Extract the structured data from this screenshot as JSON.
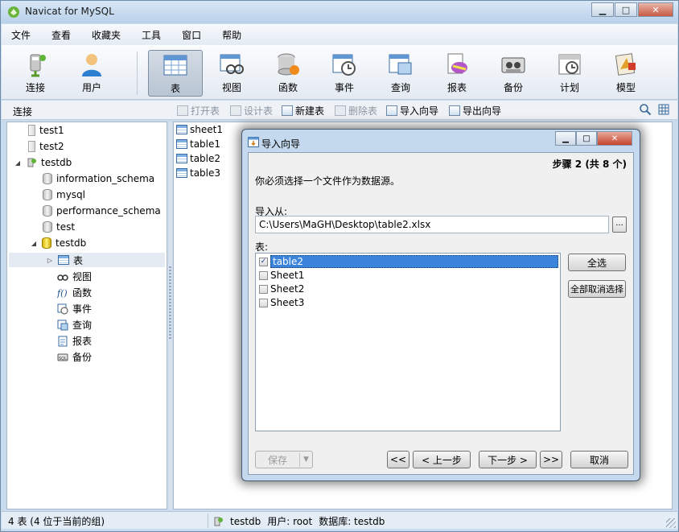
{
  "app": {
    "title": "Navicat for MySQL"
  },
  "window_controls": {
    "minimize": "▁",
    "maximize": "□",
    "close": "✕"
  },
  "menu": [
    "文件",
    "查看",
    "收藏夹",
    "工具",
    "窗口",
    "帮助"
  ],
  "toolbar": [
    {
      "label": "连接",
      "icon": "connect-icon"
    },
    {
      "label": "用户",
      "icon": "user-icon"
    },
    {
      "label": "表",
      "icon": "table-icon",
      "active": true
    },
    {
      "label": "视图",
      "icon": "view-icon"
    },
    {
      "label": "函数",
      "icon": "function-icon"
    },
    {
      "label": "事件",
      "icon": "event-icon"
    },
    {
      "label": "查询",
      "icon": "query-icon"
    },
    {
      "label": "报表",
      "icon": "report-icon"
    },
    {
      "label": "备份",
      "icon": "backup-icon"
    },
    {
      "label": "计划",
      "icon": "schedule-icon"
    },
    {
      "label": "模型",
      "icon": "model-icon"
    }
  ],
  "subbar": {
    "title": "连接",
    "actions": [
      {
        "label": "打开表",
        "enabled": false
      },
      {
        "label": "设计表",
        "enabled": false
      },
      {
        "label": "新建表",
        "enabled": true
      },
      {
        "label": "删除表",
        "enabled": false
      },
      {
        "label": "导入向导",
        "enabled": true
      },
      {
        "label": "导出向导",
        "enabled": true
      }
    ]
  },
  "tree": [
    {
      "label": "test1",
      "kind": "connection"
    },
    {
      "label": "test2",
      "kind": "connection"
    },
    {
      "label": "testdb",
      "kind": "connection-open"
    },
    {
      "label": "information_schema",
      "kind": "database"
    },
    {
      "label": "mysql",
      "kind": "database"
    },
    {
      "label": "performance_schema",
      "kind": "database"
    },
    {
      "label": "test",
      "kind": "database"
    },
    {
      "label": "testdb",
      "kind": "database-open"
    },
    {
      "label": "表",
      "kind": "tables",
      "selected": true
    },
    {
      "label": "视图",
      "kind": "views"
    },
    {
      "label": "函数",
      "kind": "functions"
    },
    {
      "label": "事件",
      "kind": "events"
    },
    {
      "label": "查询",
      "kind": "queries"
    },
    {
      "label": "报表",
      "kind": "reports"
    },
    {
      "label": "备份",
      "kind": "backups"
    }
  ],
  "tables": [
    "sheet1",
    "table1",
    "table2",
    "table3"
  ],
  "status": {
    "left": "4 表 (4 位于当前的组)",
    "connection": "testdb",
    "user": "用户: root",
    "database": "数据库: testdb"
  },
  "dialog": {
    "title": "导入向导",
    "step": "步骤 2 (共 8 个)",
    "instruction": "你必须选择一个文件作为数据源。",
    "import_from_label": "导入从:",
    "path": "C:\\Users\\MaGH\\Desktop\\table2.xlsx",
    "browse_label": "...",
    "tables_label": "表:",
    "sheets": [
      {
        "name": "table2",
        "checked": true,
        "selected": true
      },
      {
        "name": "Sheet1",
        "checked": false
      },
      {
        "name": "Sheet2",
        "checked": false
      },
      {
        "name": "Sheet3",
        "checked": false
      }
    ],
    "select_all": "全选",
    "deselect_all": "全部取消选择",
    "save": "保存",
    "first": "<<",
    "prev": "< 上一步",
    "next": "下一步 >",
    "last": ">>",
    "cancel": "取消"
  }
}
